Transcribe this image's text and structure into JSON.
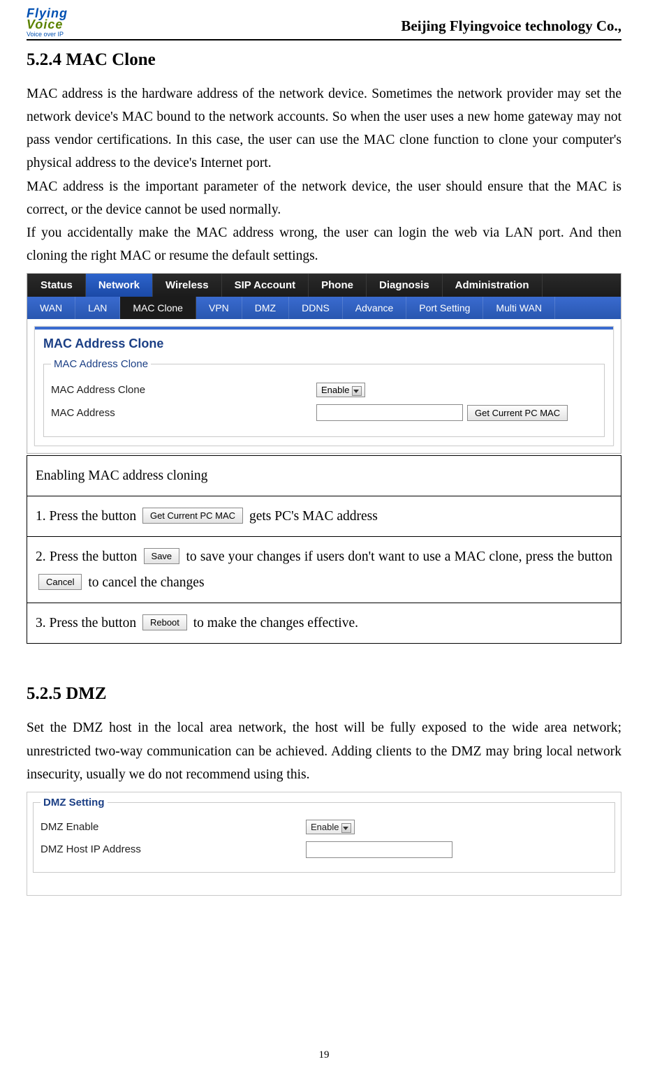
{
  "header": {
    "logo_line1": "Flying",
    "logo_line2": "Voice",
    "logo_tagline": "Voice over IP",
    "company": "Beijing Flyingvoice technology Co.,"
  },
  "mac": {
    "heading": "5.2.4 MAC Clone",
    "para1": "MAC address is the hardware address of the network device. Sometimes the network provider may set the network device's MAC bound to the network accounts. So when the user uses a new home gateway may not pass vendor certifications. In this case, the user can use the MAC clone function to clone your computer's physical address to the device's Internet port.",
    "para2": "MAC address is the important parameter of the network device, the user should ensure that the MAC is correct, or the device cannot be used normally.",
    "para3": "If you accidentally make the MAC address wrong, the user can login the web via LAN port. And then cloning the right MAC or resume the default settings."
  },
  "ui": {
    "tabs1": [
      "Status",
      "Network",
      "Wireless",
      "SIP Account",
      "Phone",
      "Diagnosis",
      "Administration"
    ],
    "tabs1_active": "Network",
    "tabs2": [
      "WAN",
      "LAN",
      "MAC Clone",
      "VPN",
      "DMZ",
      "DDNS",
      "Advance",
      "Port Setting",
      "Multi WAN"
    ],
    "tabs2_active": "MAC Clone",
    "panel_header": "MAC Address Clone",
    "legend": "MAC Address Clone",
    "row1_label": "MAC Address Clone",
    "row1_value": "Enable",
    "row2_label": "MAC Address",
    "row2_value": "",
    "get_mac_btn": "Get Current PC MAC"
  },
  "instr": {
    "title": "Enabling MAC address cloning",
    "step1_a": "1. Press the button ",
    "step1_btn": "Get Current PC MAC",
    "step1_b": " gets PC's MAC address",
    "step2_a": "2. Press the button ",
    "step2_btn1": "Save",
    "step2_b": "to save your changes if users don't want to use a MAC clone, press the button ",
    "step2_btn2": "Cancel",
    "step2_c": "to cancel the changes",
    "step3_a": "3. Press the button ",
    "step3_btn": "Reboot",
    "step3_b": " to make the changes effective."
  },
  "dmz": {
    "heading": "5.2.5 DMZ",
    "para": "Set the DMZ host in the local area network, the host will be fully exposed to the wide area network; unrestricted two-way communication can be achieved. Adding clients to the DMZ may bring local network insecurity, usually we do not recommend using this.",
    "legend": "DMZ Setting",
    "row1_label": "DMZ Enable",
    "row1_value": "Enable",
    "row2_label": "DMZ Host IP Address",
    "row2_value": ""
  },
  "page_number": "19"
}
